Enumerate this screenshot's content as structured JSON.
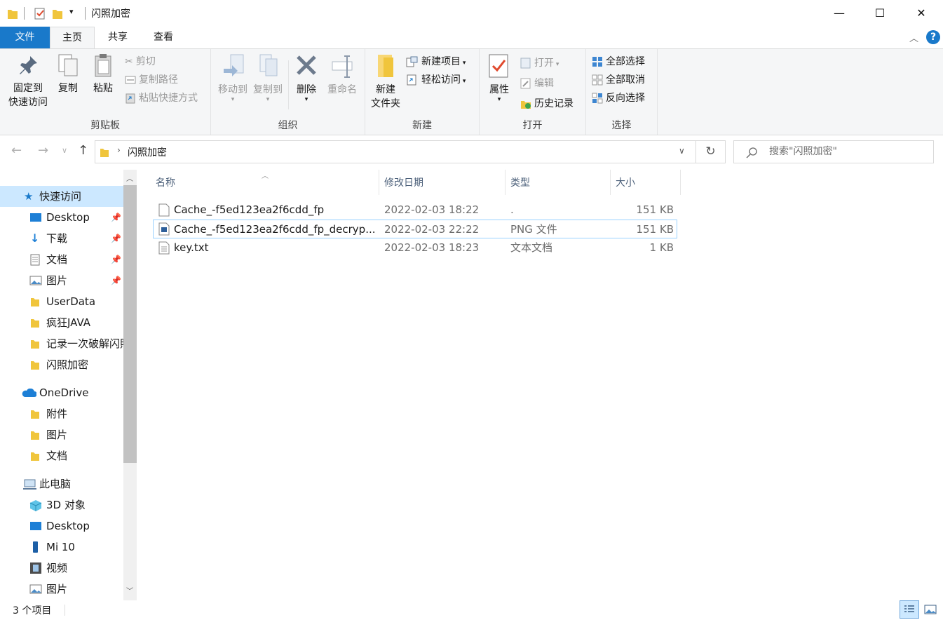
{
  "window": {
    "title": "闪照加密",
    "minimize": "—",
    "maximize": "☐",
    "close": "✕"
  },
  "tabs": {
    "file": "文件",
    "home": "主页",
    "share": "共享",
    "view": "查看"
  },
  "ribbon": {
    "clipboard": {
      "label": "剪贴板",
      "pin_line1": "固定到",
      "pin_line2": "快速访问",
      "copy": "复制",
      "paste": "粘贴",
      "cut": "剪切",
      "copy_path": "复制路径",
      "paste_shortcut": "粘贴快捷方式"
    },
    "organize": {
      "label": "组织",
      "move_to": "移动到",
      "copy_to": "复制到",
      "delete": "删除",
      "rename": "重命名"
    },
    "new": {
      "label": "新建",
      "new_folder_line1": "新建",
      "new_folder_line2": "文件夹",
      "new_item": "新建项目",
      "easy_access": "轻松访问"
    },
    "open": {
      "label": "打开",
      "properties": "属性",
      "open": "打开",
      "edit": "编辑",
      "history": "历史记录"
    },
    "select": {
      "label": "选择",
      "select_all": "全部选择",
      "select_none": "全部取消",
      "invert": "反向选择"
    }
  },
  "address": {
    "path": "闪照加密",
    "search_placeholder": "搜索\"闪照加密\""
  },
  "nav": {
    "quick_access": "快速访问",
    "items": [
      {
        "label": "Desktop",
        "pinned": true
      },
      {
        "label": "下载",
        "pinned": true
      },
      {
        "label": "文档",
        "pinned": true
      },
      {
        "label": "图片",
        "pinned": true
      },
      {
        "label": "UserData",
        "pinned": false
      },
      {
        "label": "疯狂JAVA",
        "pinned": false
      },
      {
        "label": "记录一次破解闪照",
        "pinned": false
      },
      {
        "label": "闪照加密",
        "pinned": false
      }
    ],
    "onedrive": "OneDrive",
    "onedrive_items": [
      "附件",
      "图片",
      "文档"
    ],
    "this_pc": "此电脑",
    "pc_items": [
      "3D 对象",
      "Desktop",
      "Mi 10",
      "视频",
      "图片"
    ]
  },
  "columns": {
    "name": "名称",
    "date": "修改日期",
    "type": "类型",
    "size": "大小"
  },
  "files": [
    {
      "name": "Cache_-f5ed123ea2f6cdd_fp",
      "date": "2022-02-03 18:22",
      "type": ".",
      "size": "151 KB"
    },
    {
      "name": "Cache_-f5ed123ea2f6cdd_fp_decryp...",
      "date": "2022-02-03 22:22",
      "type": "PNG 文件",
      "size": "151 KB"
    },
    {
      "name": "key.txt",
      "date": "2022-02-03 18:23",
      "type": "文本文档",
      "size": "1 KB"
    }
  ],
  "status": {
    "count": "3 个项目"
  },
  "colors": {
    "file_tab": "#1979ca",
    "folder": "#f0c53c",
    "selection_border": "#99d1ff",
    "quick_access_bg": "#cce8ff"
  }
}
